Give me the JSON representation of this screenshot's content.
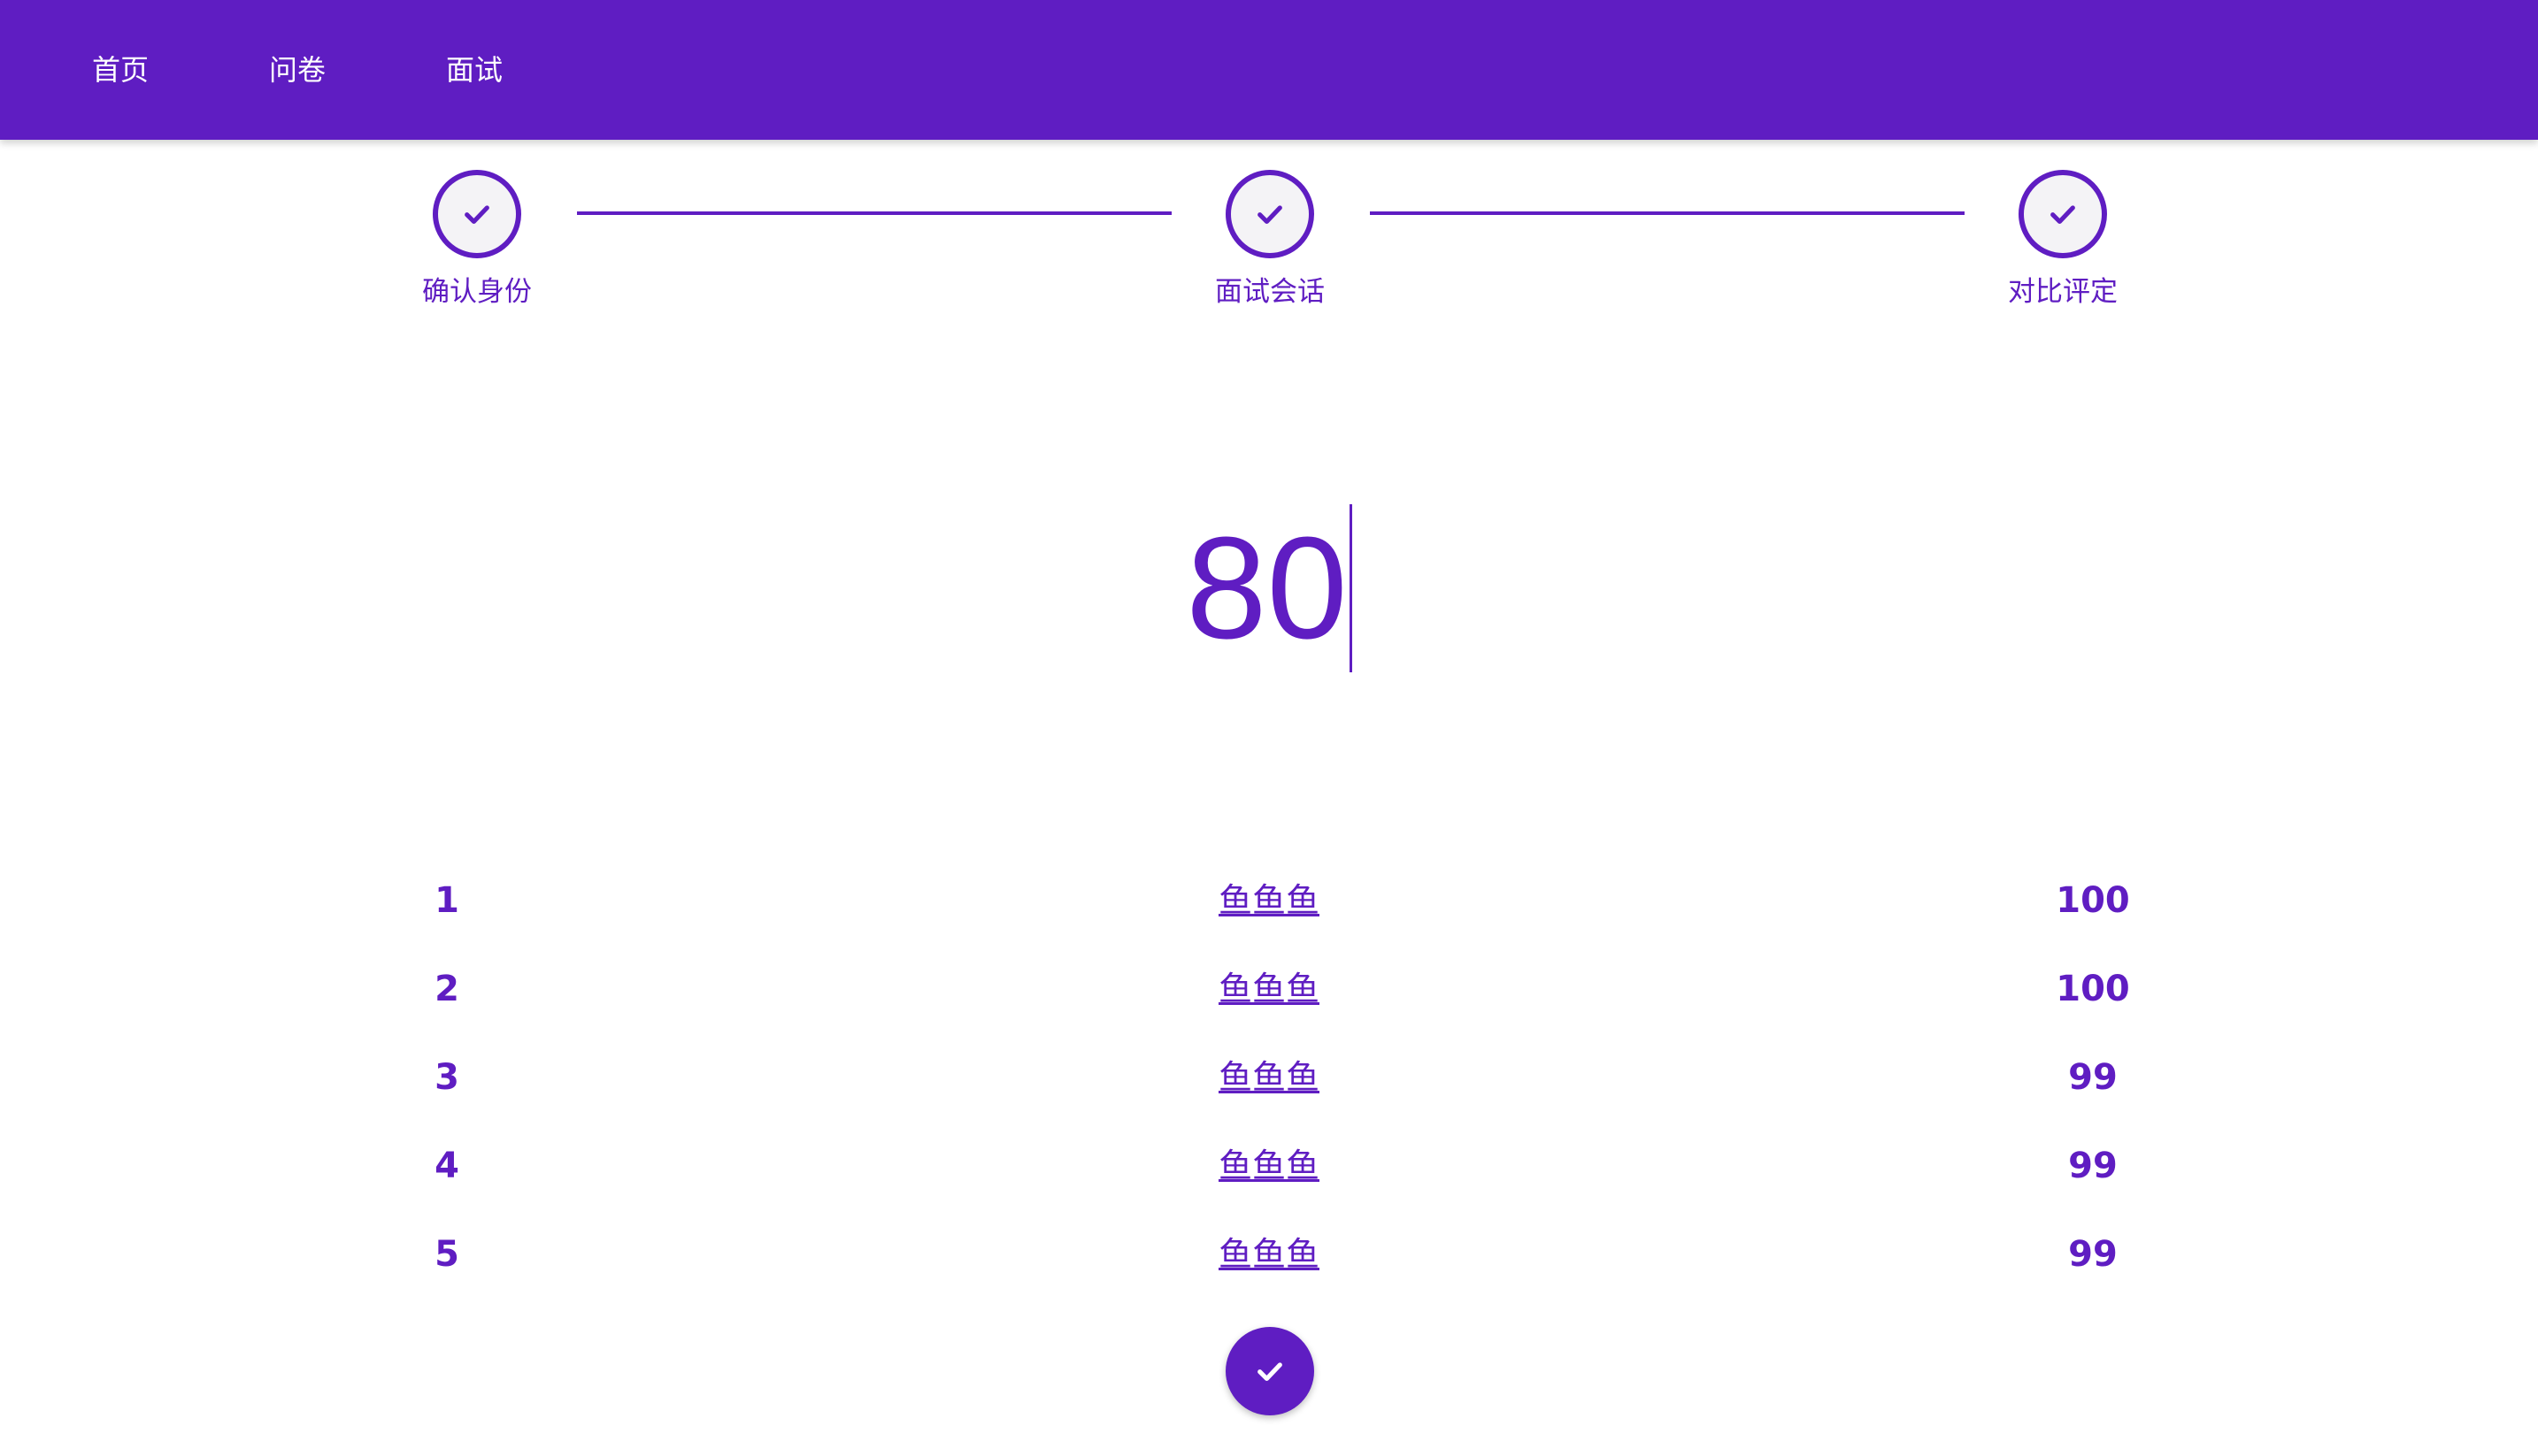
{
  "nav": {
    "items": [
      "首页",
      "问卷",
      "面试"
    ]
  },
  "stepper": {
    "steps": [
      {
        "label": "确认身份",
        "icon": "check-icon",
        "status": "completed"
      },
      {
        "label": "面试会话",
        "icon": "check-icon",
        "status": "completed"
      },
      {
        "label": "对比评定",
        "icon": "check-icon",
        "status": "completed"
      }
    ]
  },
  "score": {
    "value": "80"
  },
  "ranking": [
    {
      "rank": "1",
      "name": "鱼鱼鱼",
      "score": "100"
    },
    {
      "rank": "2",
      "name": "鱼鱼鱼",
      "score": "100"
    },
    {
      "rank": "3",
      "name": "鱼鱼鱼",
      "score": "99"
    },
    {
      "rank": "4",
      "name": "鱼鱼鱼",
      "score": "99"
    },
    {
      "rank": "5",
      "name": "鱼鱼鱼",
      "score": "99"
    }
  ],
  "submit": {
    "icon": "check-icon"
  },
  "colors": {
    "primary": "#5f1dc2",
    "circle_fill": "#f4f3f6",
    "background": "#ffffff"
  }
}
